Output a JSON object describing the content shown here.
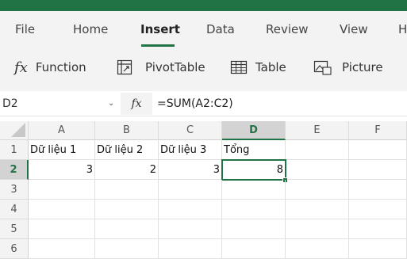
{
  "ribbon": {
    "tabs": [
      {
        "label": "File"
      },
      {
        "label": "Home"
      },
      {
        "label": "Insert"
      },
      {
        "label": "Data"
      },
      {
        "label": "Review"
      },
      {
        "label": "View"
      },
      {
        "label": "H"
      }
    ],
    "active_tab": "Insert",
    "commands": {
      "function": "Function",
      "function_icon": "fx",
      "pivottable": "PivotTable",
      "table": "Table",
      "picture": "Picture"
    }
  },
  "formula_bar": {
    "name_box": "D2",
    "fx_label": "fx",
    "formula": "=SUM(A2:C2)"
  },
  "sheet": {
    "columns": [
      "A",
      "B",
      "C",
      "D",
      "E",
      "F"
    ],
    "selected_column": "D",
    "rows": [
      "1",
      "2",
      "3",
      "4",
      "5",
      "6"
    ],
    "selected_row": "2",
    "active_cell": "D2",
    "cells": {
      "A1": "Dữ liệu 1",
      "B1": "Dữ liệu 2",
      "C1": "Dữ liệu 3",
      "D1": "Tổng",
      "A2": "3",
      "B2": "2",
      "C2": "3",
      "D2": "8"
    }
  },
  "colors": {
    "accent": "#217346",
    "ribbon_bg": "#f3f3f3"
  }
}
